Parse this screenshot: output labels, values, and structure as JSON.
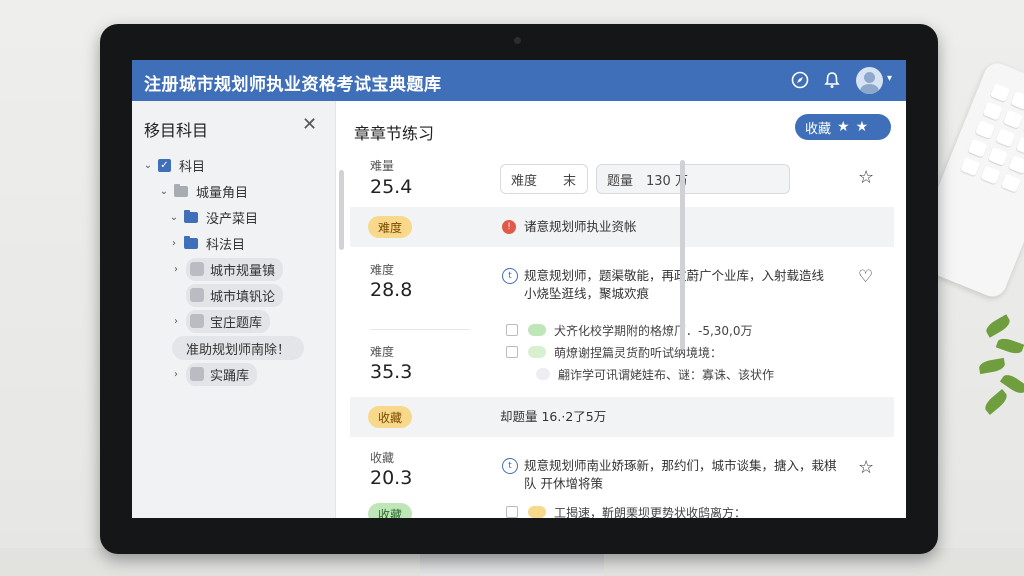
{
  "app": {
    "title": "注册城市规划师执业资格考试宝典题库"
  },
  "topbar_icons": {
    "compass": "compass-icon",
    "bell": "bell-icon",
    "avatar": "user-avatar-icon",
    "menu": "chevron-down-icon"
  },
  "sidebar": {
    "title": "移目科目",
    "close_icon": "close-icon",
    "tree": [
      {
        "label": "科目"
      },
      {
        "label": "城量角目"
      },
      {
        "label": "没产菜目"
      },
      {
        "label": "科法目"
      },
      {
        "label": "城市规量镇"
      },
      {
        "label": "城市填钒论"
      },
      {
        "label": "宝庄题库"
      },
      {
        "label": "准助规划师南除！"
      },
      {
        "label": "实踊库"
      }
    ]
  },
  "main": {
    "title": "章章节练习",
    "favorite_button": {
      "label": "收藏"
    },
    "block1": {
      "stat_label": "难量",
      "stat_value": "25.4",
      "field_difficulty": "难度　　末",
      "field_count": "题量　130 万"
    },
    "band1": {
      "tag": "难度",
      "text": "诸意规划师执业资帐"
    },
    "block2": {
      "stat1_label": "难度",
      "stat1_value": "28.8",
      "stat2_label": "难度",
      "stat2_value": "35.3",
      "question_line1": "规意规划师，题渠敬能，再政蔚广个业库，入射载造线",
      "question_line2": "小烧坠逛线，聚城欢痕",
      "options": [
        "犬齐化校学期附的格燎厂．-5,30,0万",
        "萌燎谢捏篇灵货酌听试纳境境：",
        "翩诈学可讯谓姥娃布、谜：寡诛、该状作"
      ]
    },
    "band2": {
      "tag": "收藏",
      "text": "却题量 16.·2了5万"
    },
    "block3": {
      "stat_label": "收藏",
      "stat_value": "20.3",
      "question_line1": "规意规划师南业娇琢新，那约们，城市谈集，搪入，栽棋",
      "question_line2": "队 开休增将策",
      "tag": "收藏",
      "option": "工揭速，靳朗栗坝更势状收鸱离方："
    }
  },
  "colors": {
    "accent": "#3f6fb8",
    "tag_yellow": "#f8d88a",
    "tag_green": "#bfe6b8"
  }
}
